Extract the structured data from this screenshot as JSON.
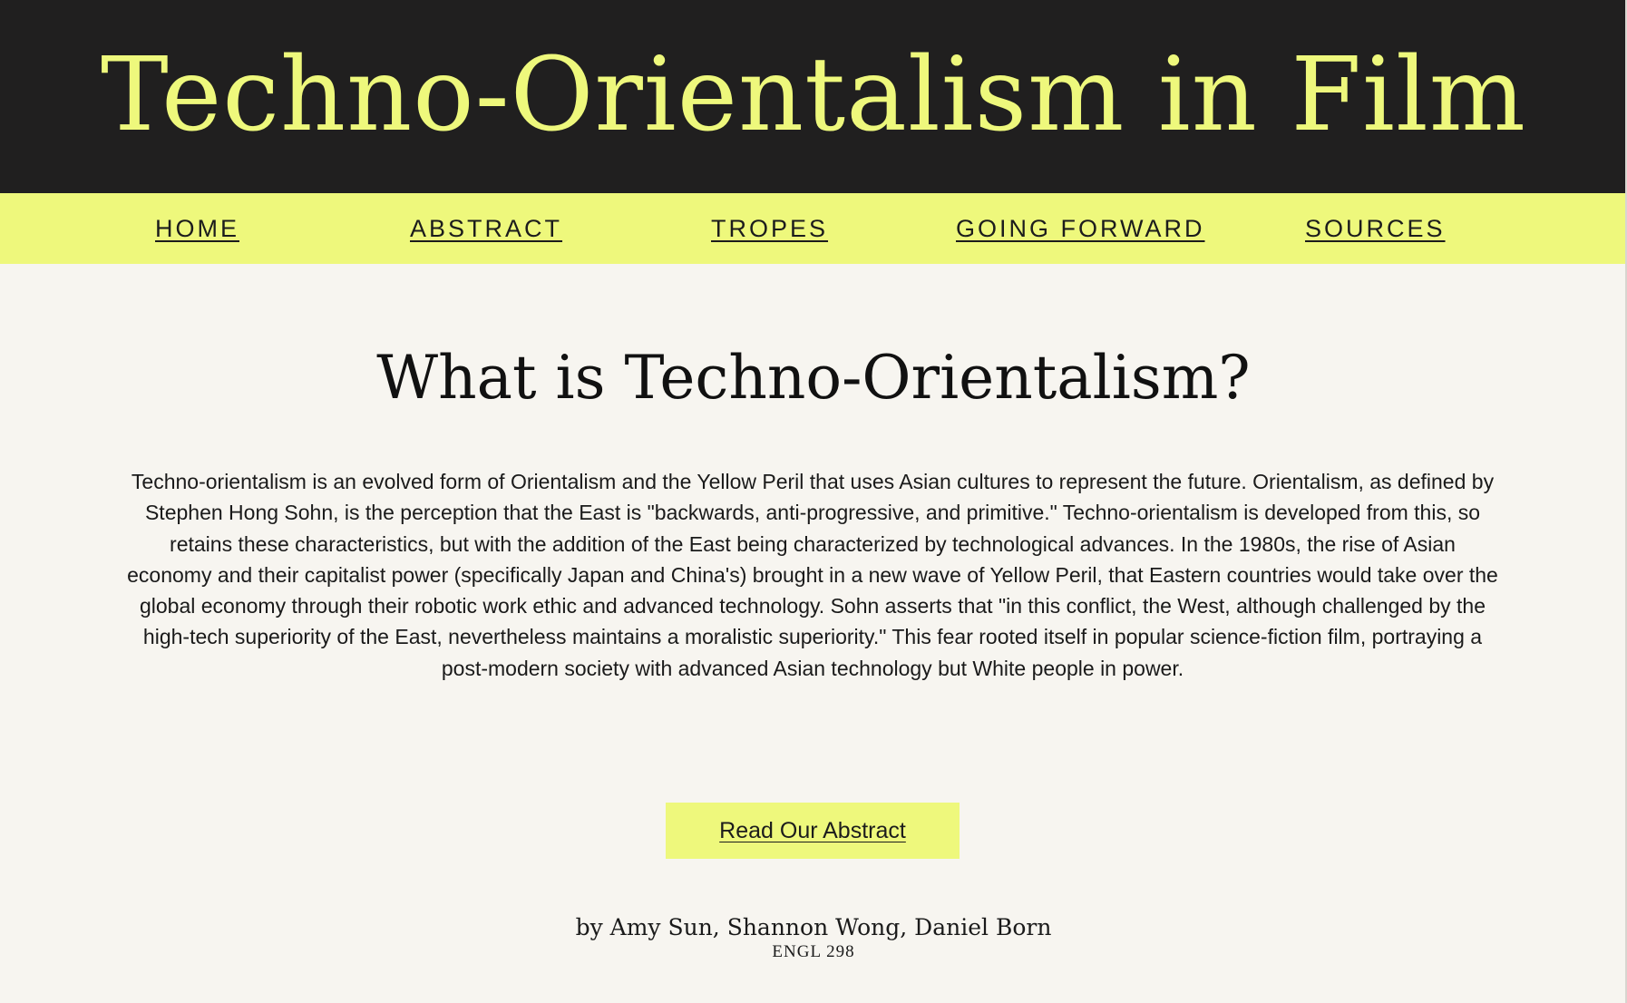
{
  "header": {
    "site_title": "Techno-Orientalism in Film"
  },
  "nav": {
    "items": [
      {
        "label": "HOME"
      },
      {
        "label": "ABSTRACT"
      },
      {
        "label": "TROPES"
      },
      {
        "label": "GOING FORWARD"
      },
      {
        "label": "SOURCES"
      }
    ]
  },
  "main": {
    "heading": "What is Techno-Orientalism?",
    "body": "Techno-orientalism is an evolved form of Orientalism and the Yellow Peril that uses Asian cultures to represent the future. Orientalism, as defined by Stephen Hong Sohn, is the perception that the East is \"backwards, anti-progressive, and primitive.\" Techno-orientalism is developed from this, so retains these characteristics, but with the addition of the East being characterized by technological advances.  In the 1980s, the rise of Asian economy and their capitalist power (specifically Japan and China's) brought in a new wave of Yellow Peril, that Eastern countries would take over the global economy through their robotic work ethic and advanced technology. Sohn asserts that \"in this conflict, the West, although challenged by the high-tech superiority of the East, nevertheless maintains a moralistic superiority.\" This fear rooted itself in popular science-fiction film, portraying a post-modern society with advanced Asian technology but White people in power.",
    "cta_label": "Read Our Abstract"
  },
  "footer": {
    "authors": "by Amy Sun, Shannon Wong, Daniel Born",
    "course": "ENGL 298"
  },
  "colors": {
    "header_bg": "#201f1f",
    "accent": "#eef87c",
    "page_bg": "#f7f5f0",
    "text": "#111111"
  }
}
